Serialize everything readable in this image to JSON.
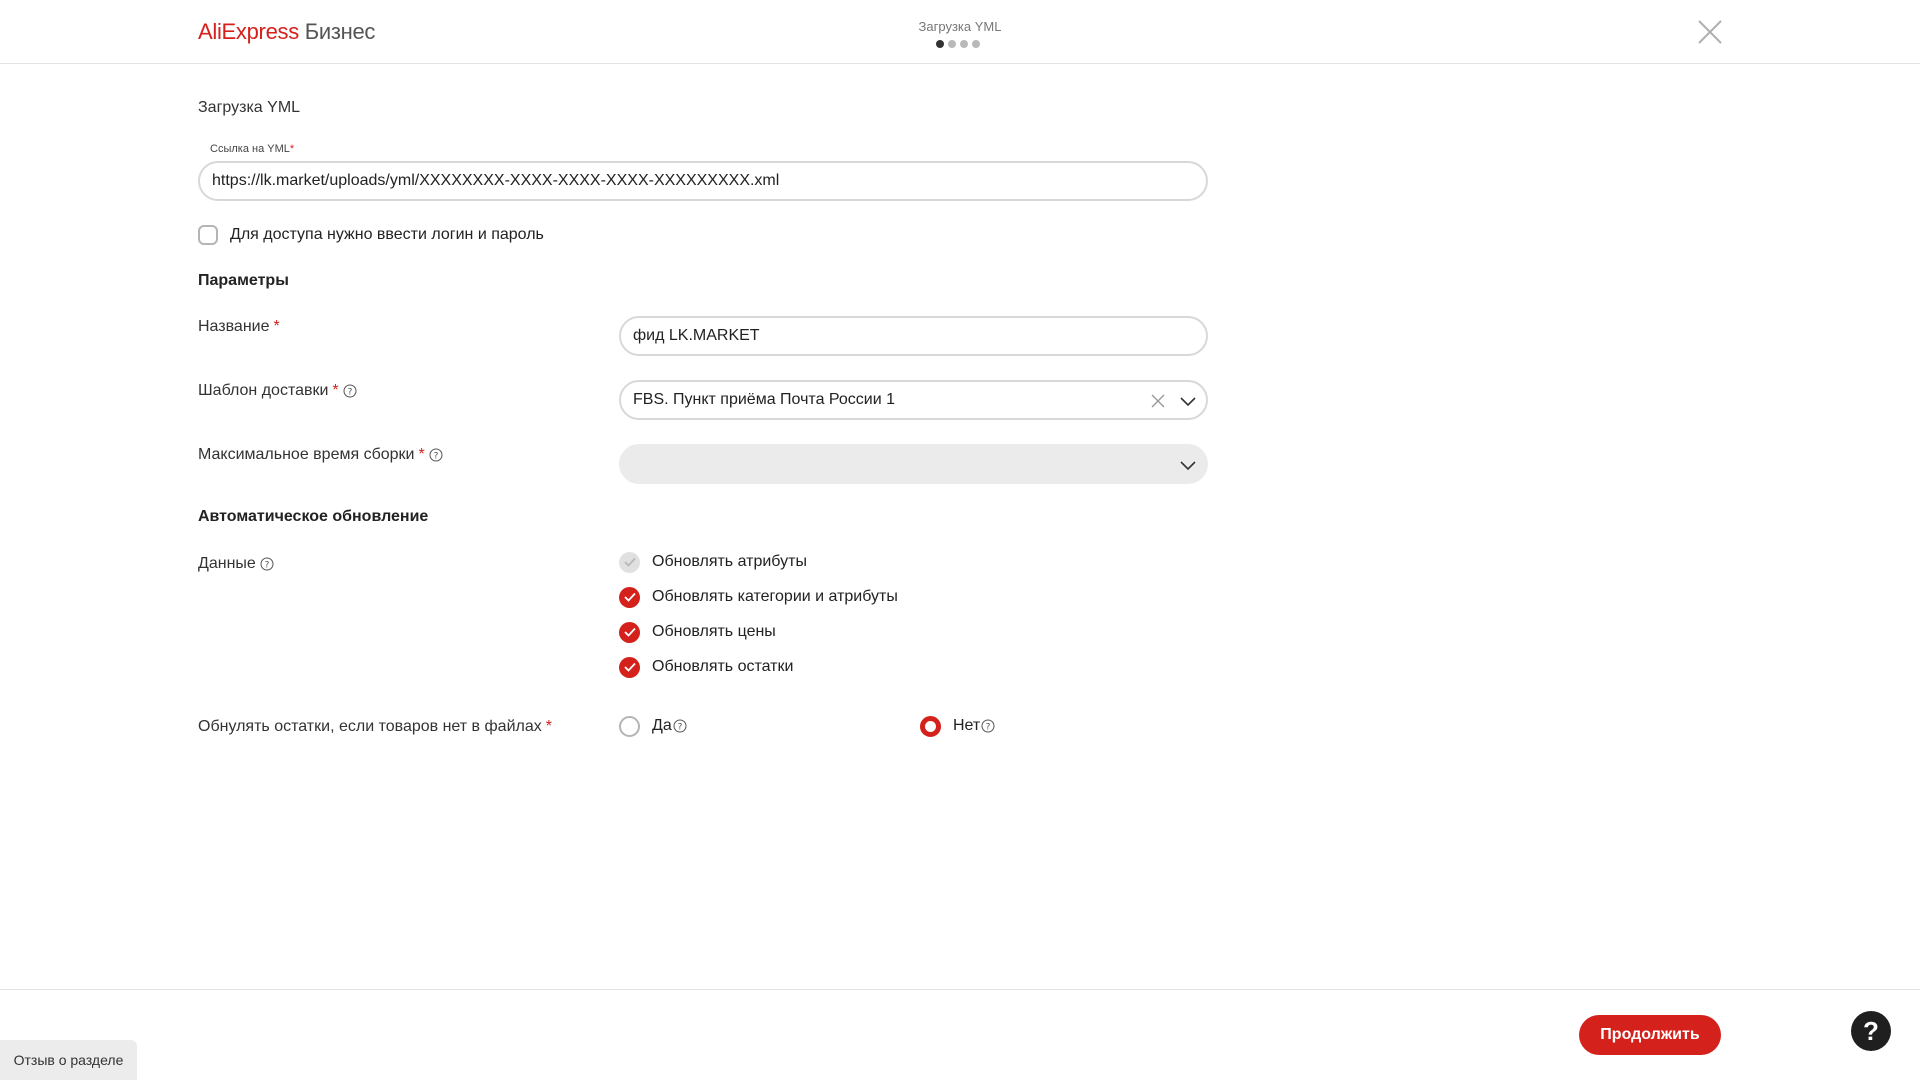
{
  "header": {
    "logo_brand": "AliExpress",
    "logo_sub": "Бизнес",
    "step_title": "Загрузка YML",
    "steps_total": 4,
    "step_current": 1
  },
  "yml": {
    "section_title": "Загрузка YML",
    "url_label": "Ссылка на YML",
    "url_value": "https://lk.market/uploads/yml/XXXXXXXX-XXXX-XXXX-XXXX-XXXXXXXXX.xml",
    "auth_checkbox_label": "Для доступа нужно ввести логин и пароль",
    "auth_checked": false
  },
  "params": {
    "section_title": "Параметры",
    "name_label": "Название",
    "name_value": "фид LK.MARKET",
    "delivery_label": "Шаблон доставки",
    "delivery_value": "FBS. Пункт приёма Почта России 1",
    "assembly_label": "Максимальное время сборки",
    "assembly_value": ""
  },
  "auto_update": {
    "section_title": "Автоматическое обновление",
    "data_label": "Данные",
    "options": [
      {
        "label": "Обновлять атрибуты",
        "state": "disabled-checked"
      },
      {
        "label": "Обновлять категории и атрибуты",
        "state": "checked"
      },
      {
        "label": "Обновлять цены",
        "state": "checked"
      },
      {
        "label": "Обновлять остатки",
        "state": "checked"
      }
    ],
    "reset_label": "Обнулять остатки, если товаров нет в файлах",
    "reset_yes": "Да",
    "reset_no": "Нет",
    "reset_selected": "Нет"
  },
  "footer": {
    "feedback_label": "Отзыв о разделе",
    "continue_label": "Продолжить",
    "help_label": "?"
  },
  "colors": {
    "accent": "#d4211c",
    "border": "#d8d8d8",
    "disabled_bg": "#ebebeb"
  },
  "required_mark": "*"
}
